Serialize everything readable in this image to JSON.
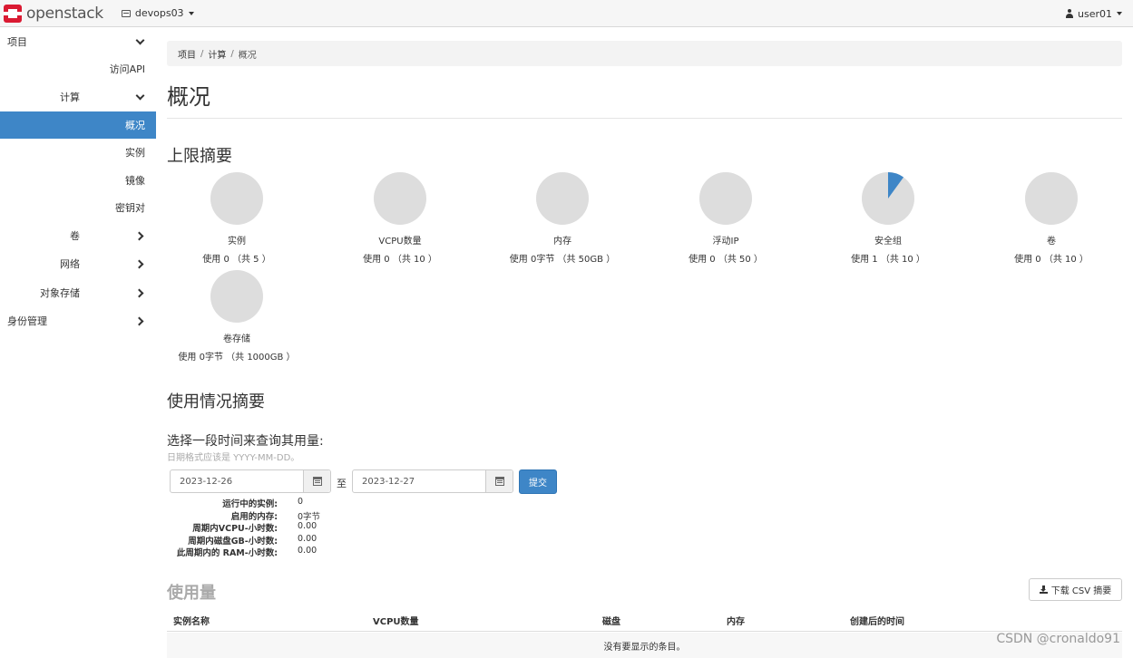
{
  "navbar": {
    "brand": "openstack",
    "project": "devops03",
    "user": "user01"
  },
  "sidebar": {
    "items": [
      {
        "label": "项目",
        "chevron": "down",
        "level": 0,
        "active": false
      },
      {
        "label": "访问API",
        "chevron": "",
        "level": 2,
        "active": false
      },
      {
        "label": "计算",
        "chevron": "down",
        "level": 1,
        "active": false
      },
      {
        "label": "概况",
        "chevron": "",
        "level": 2,
        "active": true
      },
      {
        "label": "实例",
        "chevron": "",
        "level": 2,
        "active": false
      },
      {
        "label": "镜像",
        "chevron": "",
        "level": 2,
        "active": false
      },
      {
        "label": "密钥对",
        "chevron": "",
        "level": 2,
        "active": false
      },
      {
        "label": "卷",
        "chevron": "right",
        "level": 1,
        "active": false
      },
      {
        "label": "网络",
        "chevron": "right",
        "level": 1,
        "active": false
      },
      {
        "label": "对象存储",
        "chevron": "right",
        "level": 1,
        "active": false
      },
      {
        "label": "身份管理",
        "chevron": "right",
        "level": 0,
        "active": false
      }
    ]
  },
  "breadcrumb": [
    "项目",
    "计算",
    "概况"
  ],
  "page_title": "概况",
  "limits": {
    "heading": "上限摘要",
    "colors": {
      "used": "#3e86c7",
      "free": "#dddddd"
    },
    "items": [
      {
        "title": "实例",
        "text": "使用 0 （共 5 ）",
        "used": 0,
        "total": 5
      },
      {
        "title": "VCPU数量",
        "text": "使用 0 （共 10 ）",
        "used": 0,
        "total": 10
      },
      {
        "title": "内存",
        "text": "使用 0字节 （共 50GB ）",
        "used": 0,
        "total": 50
      },
      {
        "title": "浮动IP",
        "text": "使用 0 （共 50 ）",
        "used": 0,
        "total": 50
      },
      {
        "title": "安全组",
        "text": "使用 1 （共 10 ）",
        "used": 1,
        "total": 10
      },
      {
        "title": "卷",
        "text": "使用 0 （共 10 ）",
        "used": 0,
        "total": 10
      },
      {
        "title": "卷存储",
        "text": "使用 0字节 （共 1000GB ）",
        "used": 0,
        "total": 1000
      }
    ]
  },
  "usage_summary": {
    "heading": "使用情况摘要",
    "date_heading": "选择一段时间来查询其用量:",
    "date_help": "日期格式应该是 YYYY-MM-DD。",
    "start_date": "2023-12-26",
    "to_label": "至",
    "end_date": "2023-12-27",
    "submit_label": "提交",
    "stats": [
      {
        "label": "运行中的实例:",
        "value": "0"
      },
      {
        "label": "启用的内存:",
        "value": "0字节"
      },
      {
        "label": "周期内VCPU-小时数:",
        "value": "0.00"
      },
      {
        "label": "周期内磁盘GB-小时数:",
        "value": "0.00"
      },
      {
        "label": "此周期内的 RAM-小时数:",
        "value": "0.00"
      }
    ]
  },
  "usage": {
    "heading": "使用量",
    "download_label": "下载 CSV 摘要",
    "columns": [
      "实例名称",
      "VCPU数量",
      "磁盘",
      "内存",
      "创建后的时间"
    ],
    "empty_text": "没有要显示的条目。"
  },
  "watermark": "CSDN @cronaldo91"
}
